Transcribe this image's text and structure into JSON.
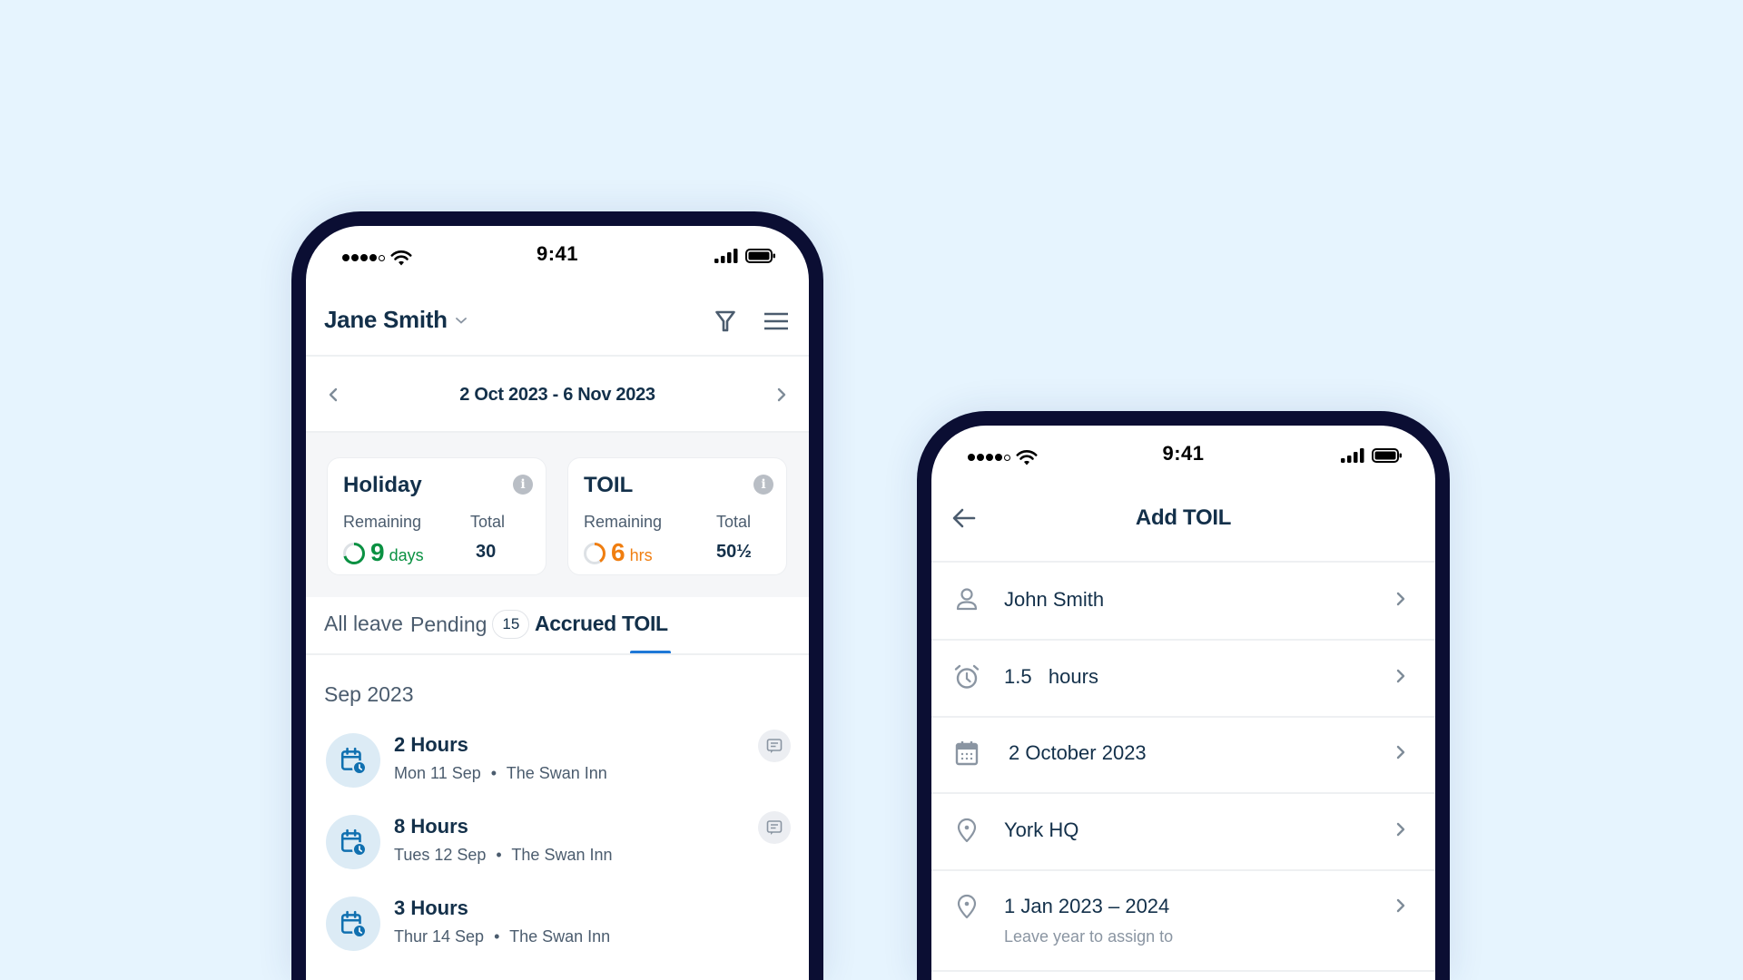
{
  "background_color": "#E6F4FE",
  "colors": {
    "bezel": "#0B0E33",
    "text_primary": "#13304A",
    "text_secondary": "#4B5C6E",
    "accent_blue": "#1E78D7",
    "icon_blue": "#1070B0",
    "green": "#0A9142",
    "orange": "#F07E10",
    "ring_track": "#DDE1E5"
  },
  "left_phone": {
    "status_bar": {
      "time": "9:41",
      "icons": [
        "signal-dots-icon",
        "wifi-icon",
        "cellular-bars-icon",
        "battery-icon"
      ]
    },
    "header": {
      "user_name": "Jane Smith",
      "icons": [
        "chevron-down-icon",
        "filter-icon",
        "hamburger-menu-icon"
      ]
    },
    "date_range": {
      "label": "2 Oct 2023 - 6 Nov 2023",
      "prev_icon": "chevron-left-icon",
      "next_icon": "chevron-right-icon"
    },
    "cards": [
      {
        "title": "Holiday",
        "remaining_label": "Remaining",
        "remaining_value": "9",
        "remaining_unit": "days",
        "total_label": "Total",
        "total_value": "30",
        "ring_fraction": 0.7,
        "color": "#0A9142"
      },
      {
        "title": "TOIL",
        "remaining_label": "Remaining",
        "remaining_value": "6",
        "remaining_unit": "hrs",
        "total_label": "Total",
        "total_value": "50½",
        "ring_fraction": 0.4,
        "color": "#F07E10"
      }
    ],
    "tabs": [
      {
        "label": "All leave",
        "active": false
      },
      {
        "label": "Pending",
        "badge": "15",
        "active": false
      },
      {
        "label": "Accrued TOIL",
        "active": true
      }
    ],
    "section_month": "Sep 2023",
    "items": [
      {
        "title": "2 Hours",
        "date": "Mon 11 Sep",
        "separator": "•",
        "location": "The Swan Inn",
        "has_comment": true
      },
      {
        "title": "8 Hours",
        "date": "Tues 12 Sep",
        "separator": "•",
        "location": "The Swan Inn",
        "has_comment": true
      },
      {
        "title": "3 Hours",
        "date": "Thur 14 Sep",
        "separator": "•",
        "location": "The Swan Inn",
        "has_comment": false
      }
    ]
  },
  "right_phone": {
    "status_bar": {
      "time": "9:41"
    },
    "header": {
      "title": "Add TOIL",
      "back_icon": "arrow-left-icon"
    },
    "rows": [
      {
        "icon": "person-icon",
        "text": "John Smith"
      },
      {
        "icon": "alarm-clock-icon",
        "text": "1.5   hours"
      },
      {
        "icon": "calendar-icon",
        "text": "2 October 2023"
      },
      {
        "icon": "location-pin-icon",
        "text": "York HQ"
      },
      {
        "icon": "location-pin-icon",
        "text": "1 Jan 2023 – 2024",
        "subtext": "Leave year to assign to"
      }
    ]
  }
}
